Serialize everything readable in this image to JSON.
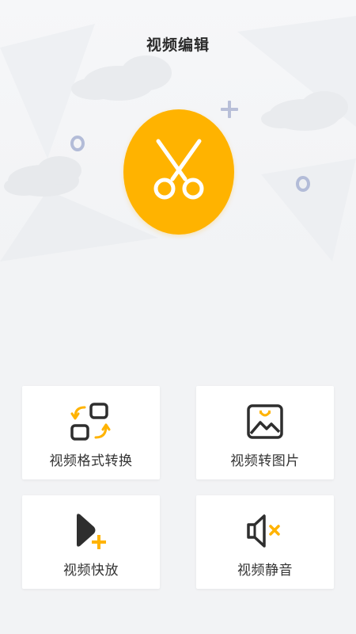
{
  "header": {
    "title": "视频编辑"
  },
  "hero": {
    "main_icon": "scissors-icon",
    "accent_color": "#ffb300",
    "deco_color": "#b8bfd8"
  },
  "features": [
    {
      "label": "视频格式转换",
      "icon": "format-convert-icon"
    },
    {
      "label": "视频转图片",
      "icon": "image-icon"
    },
    {
      "label": "视频快放",
      "icon": "play-add-icon"
    },
    {
      "label": "视频静音",
      "icon": "mute-icon"
    }
  ],
  "colors": {
    "background": "#f2f3f5",
    "card": "#ffffff",
    "icon_dark": "#2e2e2e",
    "icon_accent": "#ffb300"
  }
}
